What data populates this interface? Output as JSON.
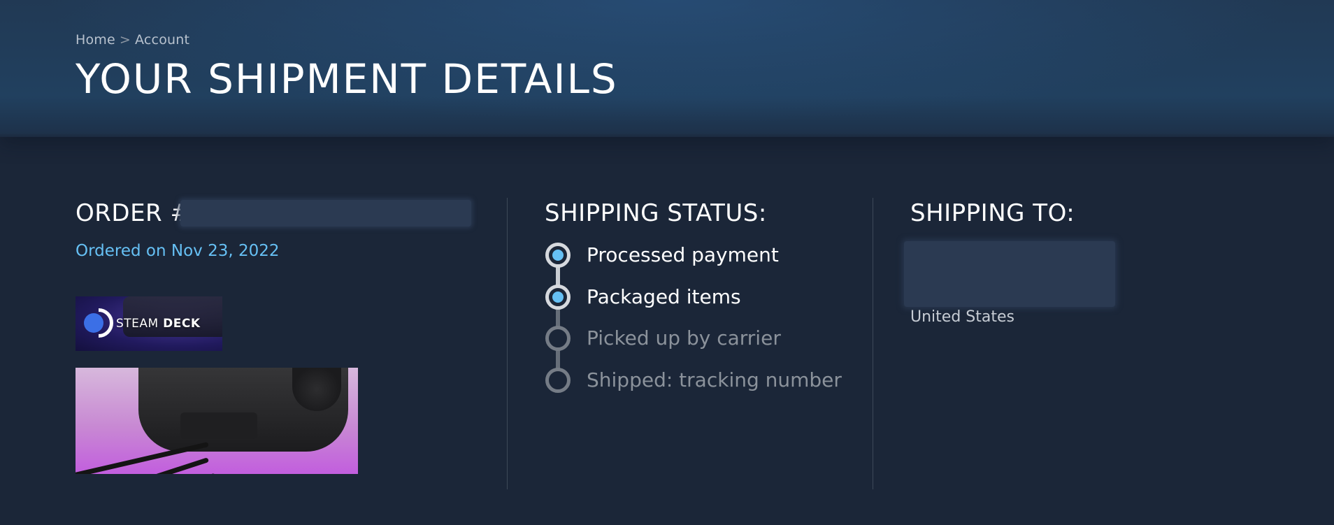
{
  "breadcrumb": {
    "items": [
      "Home",
      "Account"
    ],
    "separator": ">"
  },
  "page": {
    "title": "YOUR SHIPMENT DETAILS"
  },
  "order": {
    "heading": "ORDER #",
    "ordered_on": "Ordered on Nov 23, 2022",
    "thumbnails": [
      {
        "icon": "steam-deck-logo-thumbnail",
        "wordmark_a": "STEAM",
        "wordmark_b": "DECK"
      },
      {
        "icon": "docking-station-thumbnail"
      }
    ]
  },
  "shipping_status": {
    "heading": "SHIPPING STATUS:",
    "steps": [
      {
        "label": "Processed payment",
        "state": "done"
      },
      {
        "label": "Packaged items",
        "state": "done"
      },
      {
        "label": "Picked up by carrier",
        "state": "pending"
      },
      {
        "label": "Shipped: tracking number",
        "state": "pending"
      }
    ]
  },
  "shipping_to": {
    "heading": "SHIPPING TO:",
    "country": "United States"
  },
  "colors": {
    "background": "#1b2638",
    "accent_blue": "#66c0f4",
    "hero": "#21405f",
    "pending_text": "#8b929b"
  }
}
